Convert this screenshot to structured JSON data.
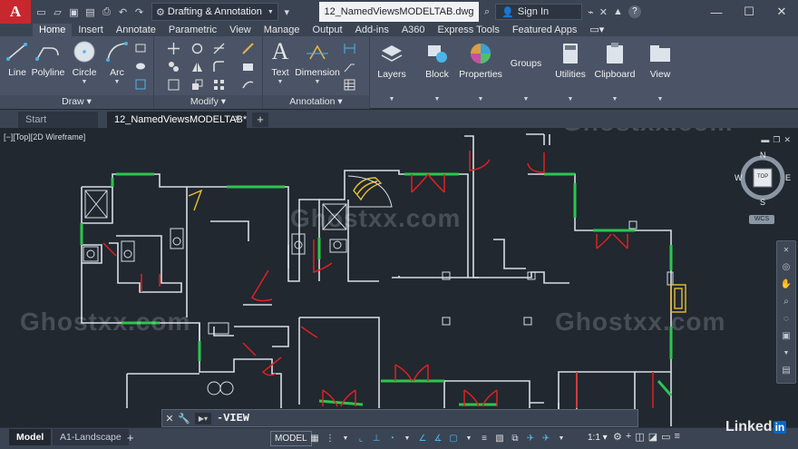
{
  "app": {
    "logo_letter": "A",
    "workspace": "Drafting & Annotation",
    "document_title": "12_NamedViewsMODELTAB.dwg",
    "signin_label": "Sign In"
  },
  "ribbon_tabs": [
    {
      "label": "Home",
      "active": true
    },
    {
      "label": "Insert"
    },
    {
      "label": "Annotate"
    },
    {
      "label": "Parametric"
    },
    {
      "label": "View"
    },
    {
      "label": "Manage"
    },
    {
      "label": "Output"
    },
    {
      "label": "Add-ins"
    },
    {
      "label": "A360"
    },
    {
      "label": "Express Tools"
    },
    {
      "label": "Featured Apps"
    }
  ],
  "ribbon": {
    "draw": {
      "title": "Draw",
      "tools": [
        "Line",
        "Polyline",
        "Circle",
        "Arc"
      ]
    },
    "modify": {
      "title": "Modify"
    },
    "annotation": {
      "title": "Annotation",
      "tools": [
        "Text",
        "Dimension"
      ]
    },
    "panels": [
      "Layers",
      "Block",
      "Properties",
      "Groups",
      "Utilities",
      "Clipboard",
      "View"
    ]
  },
  "doc_tabs": {
    "start": "Start",
    "active": "12_NamedViewsMODELTAB*"
  },
  "viewport": {
    "label": "[−][Top][2D Wireframe]",
    "viewcube": {
      "top": "TOP",
      "n": "N",
      "s": "S",
      "e": "E",
      "w": "W",
      "wcs": "WCS"
    }
  },
  "command_line": {
    "text": "-VIEW"
  },
  "status": {
    "model_tab": "Model",
    "layout_tab": "A1-Landscape",
    "model_button": "MODEL",
    "scale": "1:1"
  },
  "watermark": "Ghostxx.com",
  "branding": "Linked"
}
